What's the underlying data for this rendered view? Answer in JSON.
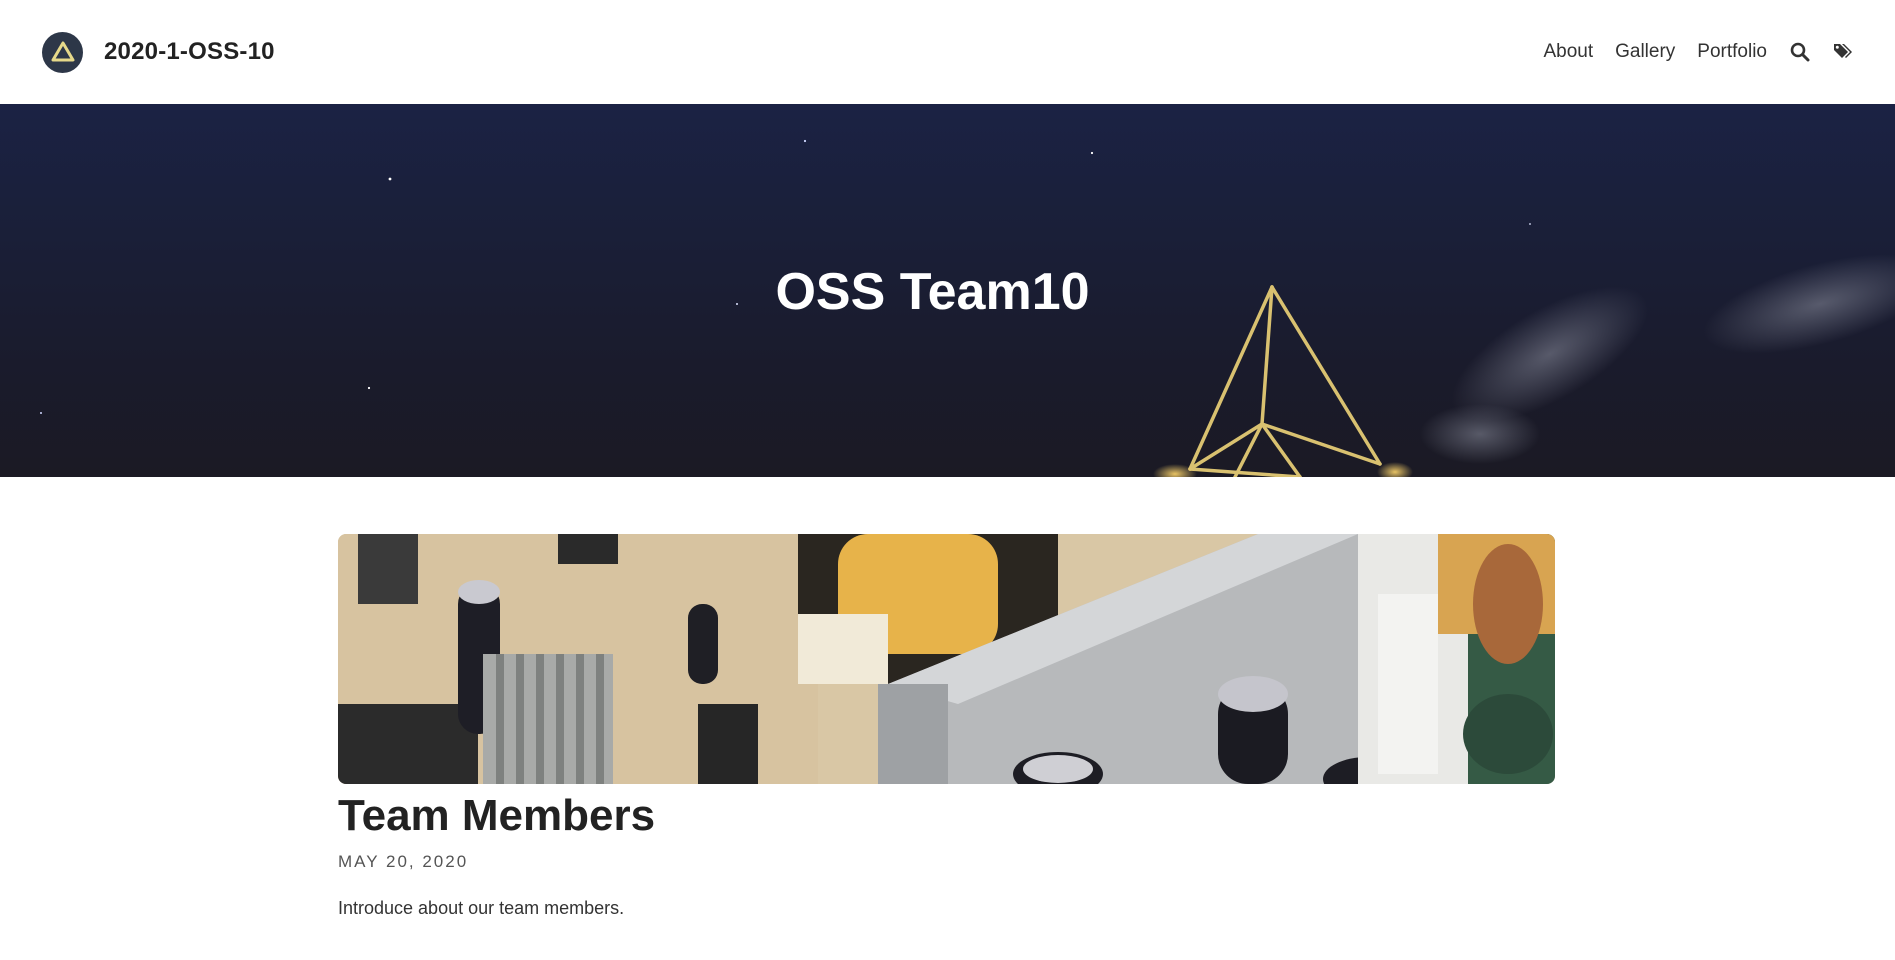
{
  "header": {
    "title": "2020-1-OSS-10",
    "logo_icon": "triangle-logo-icon",
    "nav": [
      {
        "label": "About"
      },
      {
        "label": "Gallery"
      },
      {
        "label": "Portfolio"
      }
    ],
    "search_icon": "search-icon",
    "tags_icon": "tags-icon"
  },
  "hero": {
    "title": "OSS Team10"
  },
  "post": {
    "title": "Team Members",
    "date": "MAY 20, 2020",
    "excerpt": "Introduce about our team members."
  },
  "colors": {
    "logo_bg": "#2d3748",
    "logo_triangle": "#e6d98a",
    "hero_bg": "#1a1f38",
    "text": "#222222"
  }
}
